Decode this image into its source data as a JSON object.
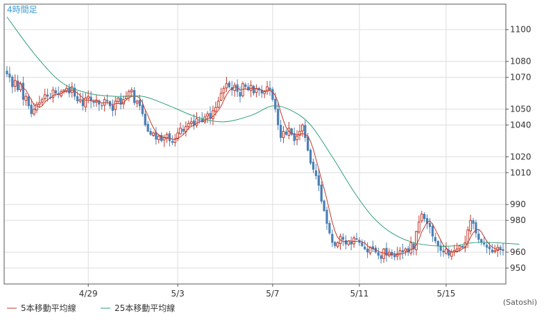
{
  "chart_data": {
    "type": "candlestick",
    "title": "4時間足",
    "credit": "(Satoshi)",
    "grid": true,
    "ylim": [
      940,
      1116
    ],
    "y_ticks": [
      950,
      960,
      980,
      990,
      1010,
      1020,
      1040,
      1050,
      1070,
      1080,
      1100
    ],
    "x_ticks": [
      {
        "label": "4/29",
        "index": 30
      },
      {
        "label": "5/3",
        "index": 63
      },
      {
        "label": "5/7",
        "index": 98
      },
      {
        "label": "5/11",
        "index": 130
      },
      {
        "label": "5/15",
        "index": 162
      }
    ],
    "colors": {
      "up": "#c0392b",
      "down": "#4a7fb5",
      "ma5": "#c0392b",
      "ma25": "#2e9e77",
      "grid": "#dddddd",
      "axis": "#555555"
    },
    "legend": [
      {
        "key": "ma5",
        "label": "5本移動平均線"
      },
      {
        "key": "ma25",
        "label": "25本移動平均線"
      }
    ],
    "closes": [
      1072,
      1070,
      1064,
      1068,
      1062,
      1066,
      1056,
      1058,
      1052,
      1047,
      1050,
      1053,
      1054,
      1056,
      1059,
      1058,
      1057,
      1062,
      1060,
      1059,
      1061,
      1062,
      1063,
      1060,
      1064,
      1058,
      1055,
      1056,
      1052,
      1057,
      1058,
      1055,
      1054,
      1055,
      1053,
      1052,
      1056,
      1055,
      1052,
      1049,
      1055,
      1057,
      1053,
      1056,
      1058,
      1061,
      1062,
      1054,
      1055,
      1052,
      1047,
      1040,
      1036,
      1034,
      1035,
      1031,
      1033,
      1030,
      1032,
      1034,
      1030,
      1029,
      1031,
      1035,
      1038,
      1036,
      1039,
      1041,
      1042,
      1040,
      1044,
      1043,
      1042,
      1045,
      1047,
      1044,
      1049,
      1051,
      1055,
      1060,
      1063,
      1066,
      1064,
      1062,
      1065,
      1061,
      1058,
      1066,
      1064,
      1062,
      1065,
      1060,
      1063,
      1062,
      1060,
      1061,
      1064,
      1062,
      1056,
      1050,
      1040,
      1032,
      1036,
      1034,
      1038,
      1034,
      1030,
      1033,
      1036,
      1040,
      1032,
      1024,
      1016,
      1012,
      1008,
      1002,
      992,
      986,
      978,
      972,
      966,
      964,
      966,
      970,
      968,
      965,
      967,
      965,
      969,
      968,
      966,
      964,
      962,
      960,
      963,
      962,
      960,
      958,
      956,
      962,
      958,
      960,
      958,
      957,
      959,
      961,
      960,
      962,
      960,
      966,
      962,
      973,
      979,
      984,
      981,
      978,
      976,
      970,
      967,
      964,
      961,
      960,
      962,
      958,
      960,
      961,
      962,
      964,
      963,
      966,
      974,
      980,
      978,
      972,
      968,
      966,
      965,
      963,
      962,
      960,
      961,
      963,
      962,
      961
    ],
    "ma25_anchors": [
      {
        "i": 0,
        "v": 1108
      },
      {
        "i": 10,
        "v": 1085
      },
      {
        "i": 20,
        "v": 1067
      },
      {
        "i": 30,
        "v": 1060
      },
      {
        "i": 40,
        "v": 1058
      },
      {
        "i": 50,
        "v": 1058
      },
      {
        "i": 60,
        "v": 1052
      },
      {
        "i": 70,
        "v": 1045
      },
      {
        "i": 80,
        "v": 1042
      },
      {
        "i": 90,
        "v": 1046
      },
      {
        "i": 98,
        "v": 1052
      },
      {
        "i": 105,
        "v": 1049
      },
      {
        "i": 112,
        "v": 1040
      },
      {
        "i": 120,
        "v": 1020
      },
      {
        "i": 128,
        "v": 998
      },
      {
        "i": 135,
        "v": 982
      },
      {
        "i": 142,
        "v": 972
      },
      {
        "i": 150,
        "v": 966
      },
      {
        "i": 158,
        "v": 964
      },
      {
        "i": 165,
        "v": 964
      },
      {
        "i": 172,
        "v": 966
      },
      {
        "i": 180,
        "v": 966
      },
      {
        "i": 189,
        "v": 965
      }
    ]
  }
}
